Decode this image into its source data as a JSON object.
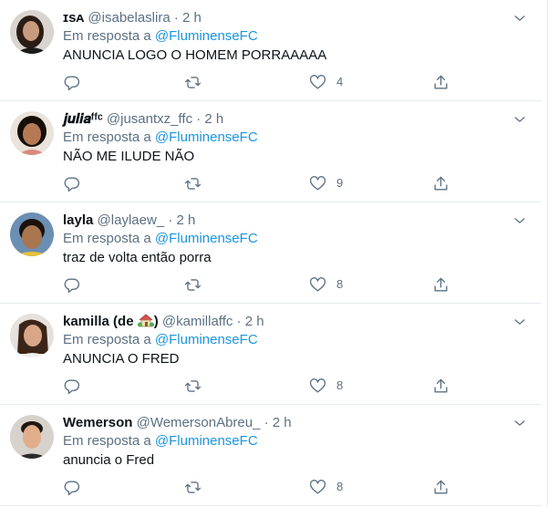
{
  "reply_prefix": "Em resposta a",
  "tweets": [
    {
      "display_name": "ɪsᴀ",
      "handle": "@isabelaslira",
      "time": "2 h",
      "reply_to": "@FluminenseFC",
      "text": "ANUNCIA LOGO O HOMEM PORRAAAAA",
      "likes": "4",
      "avatar_colors": {
        "bg": "#d9d4cf",
        "skin": "#c99b7e",
        "hair": "#2a1d16",
        "shirt": "#1c1c1c"
      }
    },
    {
      "display_name": "𝒋𝒖𝒍𝒊𝒂ᶠᶠᶜ",
      "handle": "@jusantxz_ffc",
      "time": "2 h",
      "reply_to": "@FluminenseFC",
      "text": "NÃO ME ILUDE NÃO",
      "likes": "9",
      "avatar_colors": {
        "bg": "#e9e3dc",
        "skin": "#b57a55",
        "hair": "#160e09",
        "shirt": "#d98b7a"
      }
    },
    {
      "display_name": "layla",
      "handle": "@laylaew_",
      "time": "2 h",
      "reply_to": "@FluminenseFC",
      "text": "traz de volta então porra",
      "likes": "8",
      "avatar_colors": {
        "bg": "#6b8fb3",
        "skin": "#a8764f",
        "hair": "#1a120c",
        "shirt": "#e6c13a"
      }
    },
    {
      "display_name": "kamilla (de",
      "display_name_close": ")",
      "handle": "@kamillaffc",
      "time": "2 h",
      "reply_to": "@FluminenseFC",
      "text": "ANUNCIA O FRED",
      "likes": "8",
      "name_emoji": "house-with-garden-icon",
      "avatar_colors": {
        "bg": "#e6e1dd",
        "skin": "#d8a788",
        "hair": "#3b2418",
        "shirt": "#f2eeea"
      }
    },
    {
      "display_name": "Wemerson",
      "handle": "@WemersonAbreu_",
      "time": "2 h",
      "reply_to": "@FluminenseFC",
      "text": "anuncia o Fred",
      "likes": "8",
      "avatar_colors": {
        "bg": "#d7d2cc",
        "skin": "#e0ae8b",
        "hair": "#1f1711",
        "shirt": "#2b2b2b"
      }
    }
  ],
  "icons": {
    "reply": "reply-icon",
    "retweet": "retweet-icon",
    "like": "heart-icon",
    "share": "share-icon",
    "more": "chevron-down-icon"
  },
  "colors": {
    "link": "#1b95e0",
    "secondary": "#5b7083",
    "border": "#e6ecf0"
  }
}
